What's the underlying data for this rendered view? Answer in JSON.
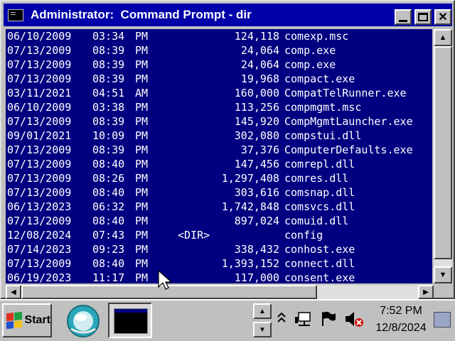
{
  "window": {
    "title": "Administrator:  Command Prompt - dir",
    "minimize_label": "_",
    "close_label": "✕"
  },
  "console": {
    "lines": [
      {
        "date": "06/10/2009",
        "time": "03:34",
        "ampm": "PM",
        "dir": "",
        "size": "124,118",
        "name": "comexp.msc"
      },
      {
        "date": "07/13/2009",
        "time": "08:39",
        "ampm": "PM",
        "dir": "",
        "size": "24,064",
        "name": "comp.exe"
      },
      {
        "date": "07/13/2009",
        "time": "08:39",
        "ampm": "PM",
        "dir": "",
        "size": "24,064",
        "name": "comp.exe"
      },
      {
        "date": "07/13/2009",
        "time": "08:39",
        "ampm": "PM",
        "dir": "",
        "size": "19,968",
        "name": "compact.exe"
      },
      {
        "date": "03/11/2021",
        "time": "04:51",
        "ampm": "AM",
        "dir": "",
        "size": "160,000",
        "name": "CompatTelRunner.exe"
      },
      {
        "date": "06/10/2009",
        "time": "03:38",
        "ampm": "PM",
        "dir": "",
        "size": "113,256",
        "name": "compmgmt.msc"
      },
      {
        "date": "07/13/2009",
        "time": "08:39",
        "ampm": "PM",
        "dir": "",
        "size": "145,920",
        "name": "CompMgmtLauncher.exe"
      },
      {
        "date": "09/01/2021",
        "time": "10:09",
        "ampm": "PM",
        "dir": "",
        "size": "302,080",
        "name": "compstui.dll"
      },
      {
        "date": "07/13/2009",
        "time": "08:39",
        "ampm": "PM",
        "dir": "",
        "size": "37,376",
        "name": "ComputerDefaults.exe"
      },
      {
        "date": "07/13/2009",
        "time": "08:40",
        "ampm": "PM",
        "dir": "",
        "size": "147,456",
        "name": "comrepl.dll"
      },
      {
        "date": "07/13/2009",
        "time": "08:26",
        "ampm": "PM",
        "dir": "",
        "size": "1,297,408",
        "name": "comres.dll"
      },
      {
        "date": "07/13/2009",
        "time": "08:40",
        "ampm": "PM",
        "dir": "",
        "size": "303,616",
        "name": "comsnap.dll"
      },
      {
        "date": "06/13/2023",
        "time": "06:32",
        "ampm": "PM",
        "dir": "",
        "size": "1,742,848",
        "name": "comsvcs.dll"
      },
      {
        "date": "07/13/2009",
        "time": "08:40",
        "ampm": "PM",
        "dir": "",
        "size": "897,024",
        "name": "comuid.dll"
      },
      {
        "date": "12/08/2024",
        "time": "07:43",
        "ampm": "PM",
        "dir": "<DIR>",
        "size": "",
        "name": "config"
      },
      {
        "date": "07/14/2023",
        "time": "09:23",
        "ampm": "PM",
        "dir": "",
        "size": "338,432",
        "name": "conhost.exe"
      },
      {
        "date": "07/13/2009",
        "time": "08:40",
        "ampm": "PM",
        "dir": "",
        "size": "1,393,152",
        "name": "connect.dll"
      },
      {
        "date": "06/19/2023",
        "time": "11:17",
        "ampm": "PM",
        "dir": "",
        "size": "117,000",
        "name": "consent.exe"
      }
    ]
  },
  "scrollbar": {
    "up_arrow": "▲",
    "down_arrow": "▼",
    "left_arrow": "◀",
    "right_arrow": "▶"
  },
  "taskbar": {
    "start_label": "Start",
    "clock_time": "7:52 PM",
    "clock_date": "12/8/2024",
    "tray_up": "▲",
    "tray_down": "▼"
  },
  "colors": {
    "console_bg": "#000080",
    "title_bg": "#0000aa",
    "desktop": "#008080"
  }
}
